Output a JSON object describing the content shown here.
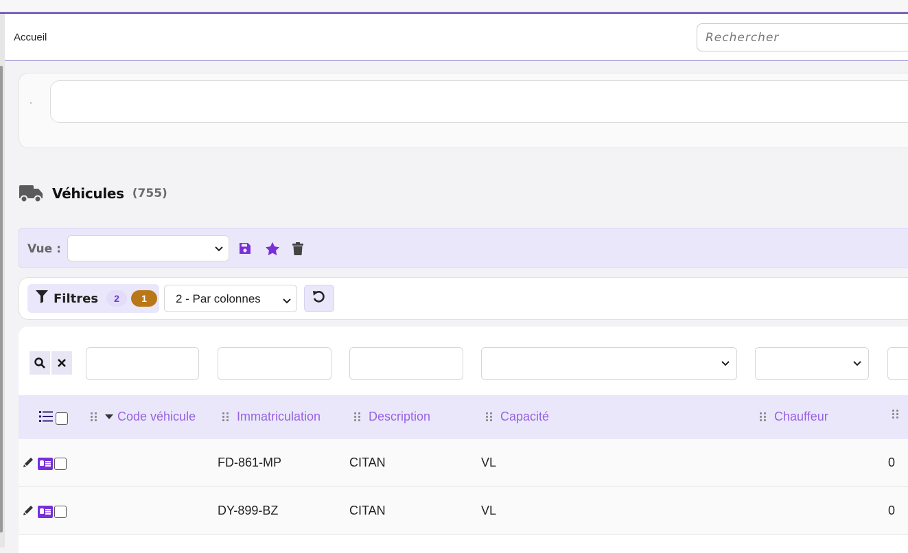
{
  "breadcrumb": {
    "home": "Accueil"
  },
  "search": {
    "placeholder": "Rechercher"
  },
  "page": {
    "title": "Véhicules",
    "count": "(755)"
  },
  "vue": {
    "label": "Vue :",
    "selected": ""
  },
  "filters": {
    "label": "Filtres",
    "badge_count": "2",
    "badge_active": "1",
    "mode_selected": "2 - Par colonnes"
  },
  "columns": [
    {
      "label": "Code véhicule",
      "sorted": "desc"
    },
    {
      "label": "Immatriculation"
    },
    {
      "label": "Description"
    },
    {
      "label": "Capacité"
    },
    {
      "label": "Chauffeur"
    }
  ],
  "rows": [
    {
      "code": "",
      "immatriculation": "FD-861-MP",
      "description": "CITAN",
      "capacite": "VL",
      "chauffeur": "",
      "extra": "0"
    },
    {
      "code": "",
      "immatriculation": "DY-899-BZ",
      "description": "CITAN",
      "capacite": "VL",
      "chauffeur": "",
      "extra": "0"
    }
  ],
  "colors": {
    "accent": "#7a2fd8",
    "header_bg": "#ebe7fb",
    "header_text": "#9663e0",
    "badge_orange": "#b97717"
  }
}
